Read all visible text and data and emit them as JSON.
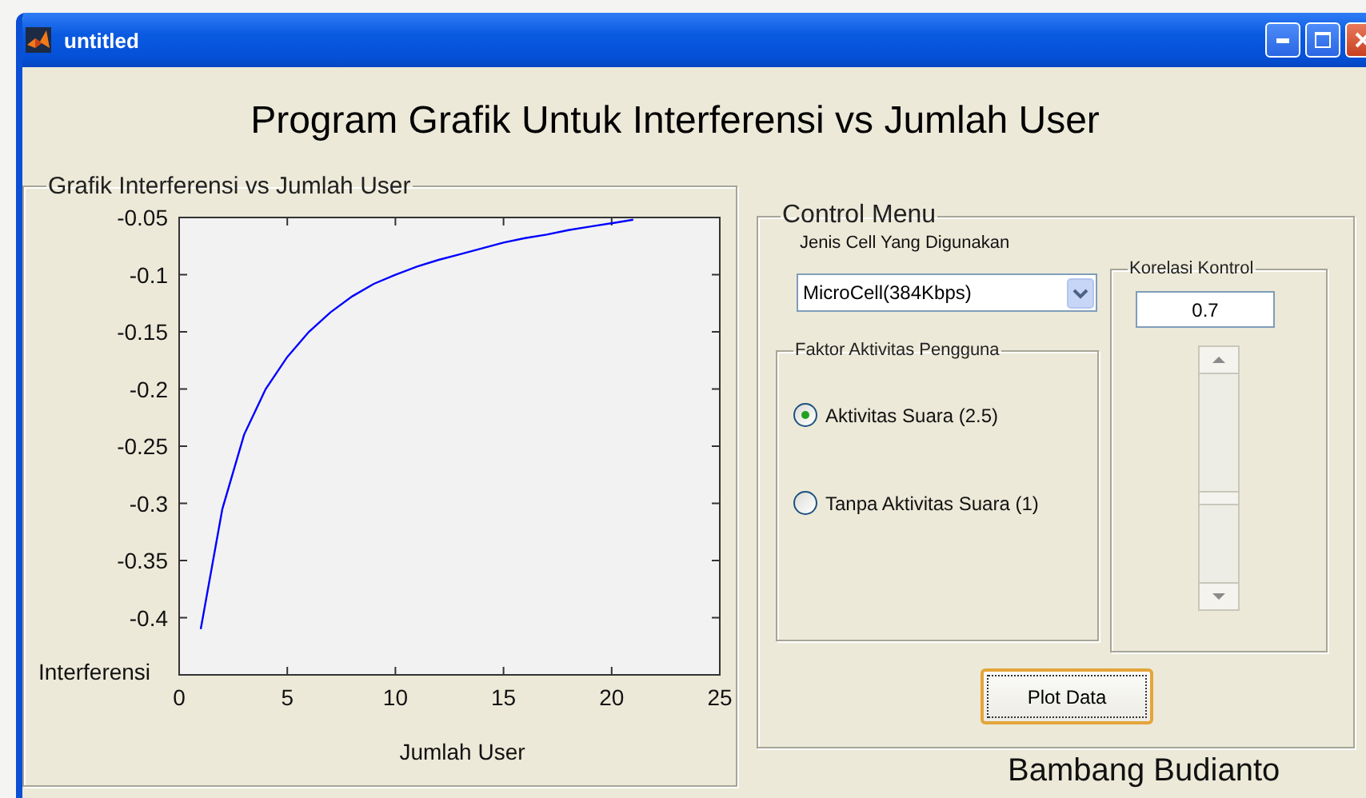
{
  "window": {
    "title": "untitled"
  },
  "heading": "Program Grafik Untuk Interferensi vs Jumlah User",
  "graph_panel": {
    "title": "Grafik Interferensi vs Jumlah User",
    "chart_data": {
      "type": "line",
      "xlabel": "Jumlah User",
      "ylabel": "Interferensi",
      "x": [
        1,
        2,
        3,
        4,
        5,
        6,
        7,
        8,
        9,
        10,
        11,
        12,
        13,
        14,
        15,
        16,
        17,
        18,
        19,
        20,
        21
      ],
      "series": [
        {
          "color": "#0000ff",
          "values": [
            -0.41,
            -0.305,
            -0.24,
            -0.2,
            -0.172,
            -0.15,
            -0.133,
            -0.119,
            -0.108,
            -0.1,
            -0.093,
            -0.087,
            -0.082,
            -0.077,
            -0.072,
            -0.068,
            -0.065,
            -0.061,
            -0.058,
            -0.055,
            -0.052
          ]
        }
      ],
      "xlim": [
        0,
        25
      ],
      "ylim": [
        -0.45,
        -0.05
      ],
      "xticks": [
        0,
        5,
        10,
        15,
        20,
        25
      ],
      "yticks": [
        -0.4,
        -0.35,
        -0.3,
        -0.25,
        -0.2,
        -0.15,
        -0.1,
        -0.05
      ]
    }
  },
  "control_menu": {
    "title": "Control Menu",
    "cell_label": "Jenis Cell Yang Digunakan",
    "cell_dropdown": {
      "value": "MicroCell(384Kbps)"
    },
    "activity_panel": {
      "title": "Faktor Aktivitas Pengguna",
      "options": [
        {
          "label": "Aktivitas Suara (2.5)",
          "selected": true
        },
        {
          "label": "Tanpa Aktivitas Suara (1)",
          "selected": false
        }
      ]
    },
    "correlation_panel": {
      "title": "Korelasi Kontrol",
      "value": "0.7",
      "slider": {
        "level": 0.4
      }
    },
    "plot_button": "Plot Data"
  },
  "author": "Bambang Budianto"
}
